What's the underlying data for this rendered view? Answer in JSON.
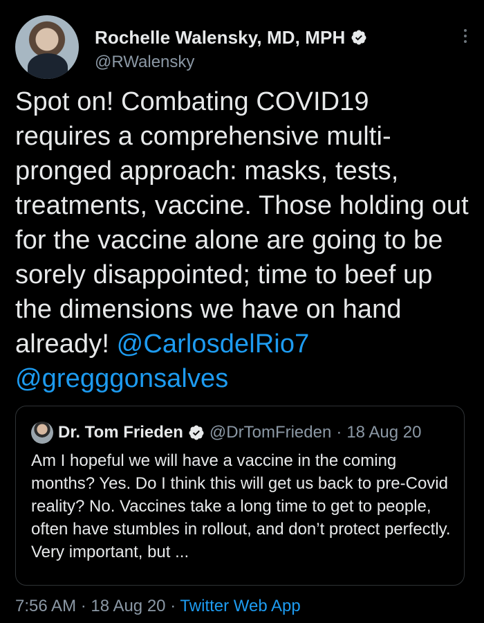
{
  "author": {
    "name": "Rochelle Walensky, MD, MPH",
    "handle": "@RWalensky"
  },
  "tweet": {
    "text": "Spot on! Combating COVID19 requires a comprehensive multi-pronged approach: masks, tests, treatments, vaccine. Those holding out for the vaccine alone are going to be sorely disappointed; time to beef up the dimensions we have on hand already! ",
    "mentions": [
      "@CarlosdelRio7",
      "@gregggonsalves"
    ]
  },
  "quote": {
    "name": "Dr. Tom Frieden",
    "handle": "@DrTomFrieden",
    "separator": "·",
    "date": "18 Aug 20",
    "text": "Am I hopeful we will have a vaccine in the coming months? Yes. Do I think this will get us back to pre-Covid reality? No. Vaccines take a long time to get to people, often have stumbles in rollout, and don’t protect perfectly. Very important, but ..."
  },
  "meta": {
    "time": "7:56 AM",
    "separator": "·",
    "date": "18 Aug 20",
    "source": "Twitter Web App"
  },
  "colors": {
    "background": "#000000",
    "text": "#e7e9ea",
    "muted": "#8b98a5",
    "accent": "#1d9bf0"
  },
  "icons": [
    "verified-badge-icon",
    "more-options-icon"
  ]
}
